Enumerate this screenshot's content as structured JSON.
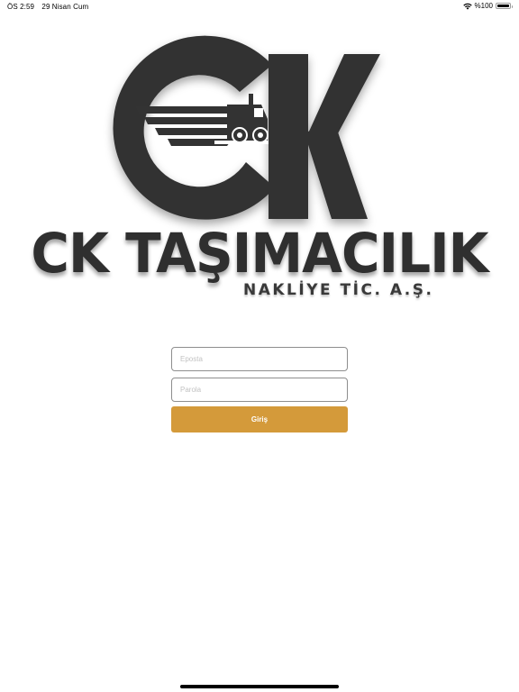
{
  "status_bar": {
    "time": "ÖS 2:59",
    "date": "29 Nisan Cum",
    "battery": "%100",
    "battery_level": 1.0,
    "wifi_icon": "wifi-icon",
    "battery_icon": "battery-icon"
  },
  "branding": {
    "logo_icon": "ck-truck-logo",
    "company_name": "CK TAŞIMACILIK",
    "company_subtitle": "NAKLİYE TİC. A.Ş.",
    "logo_color": "#333333"
  },
  "login": {
    "email_placeholder": "Eposta",
    "email_value": "",
    "password_placeholder": "Parola",
    "password_value": "",
    "submit_label": "Giriş",
    "accent_color": "#d49a3a"
  }
}
